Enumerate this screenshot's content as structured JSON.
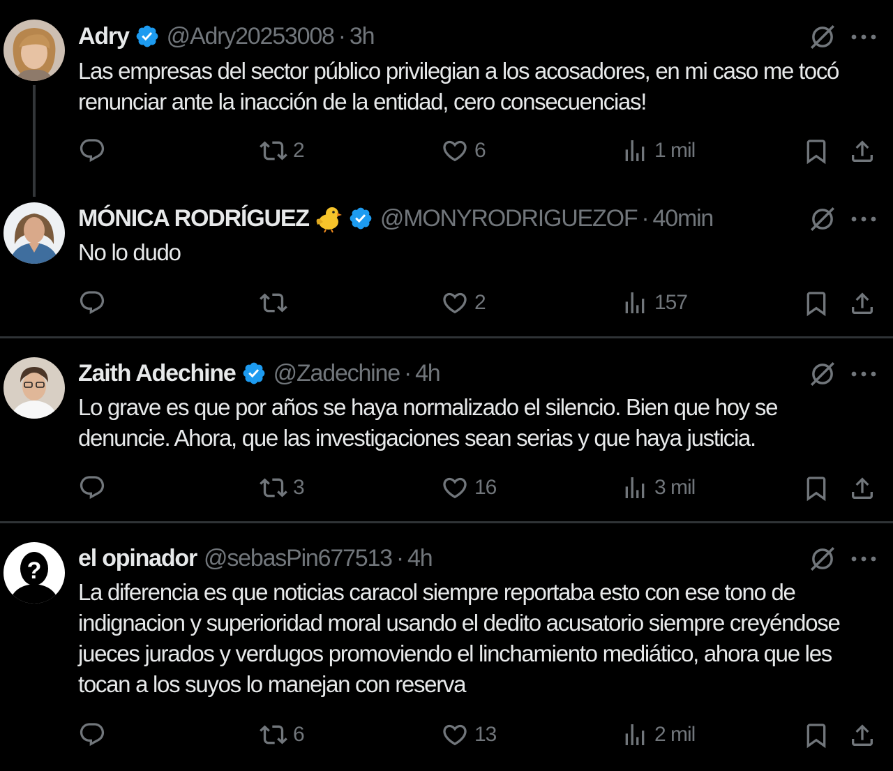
{
  "colors": {
    "background": "#000000",
    "text": "#e7e9ea",
    "muted": "#71767b",
    "verified": "#1d9bf0",
    "divider": "#2f3336"
  },
  "tweets": [
    {
      "name": "Adry",
      "handle": "@Adry20253008",
      "separator": "·",
      "time": "3h",
      "verified": true,
      "text": "Las empresas del sector público privilegian a los acosadores, en mi caso me tocó renunciar ante la inacción de la entidad, cero consecuencias!",
      "replies": "",
      "reposts": "2",
      "likes": "6",
      "views": "1 mil"
    },
    {
      "name": "MÓNICA RODRÍGUEZ",
      "handle": "@MONYRODRIGUEZOF",
      "separator": "·",
      "time": "40min",
      "verified": true,
      "emoji": "chick-emoji-icon",
      "text": "No lo dudo",
      "replies": "",
      "reposts": "",
      "likes": "2",
      "views": "157"
    },
    {
      "name": "Zaith Adechine",
      "handle": "@Zadechine",
      "separator": "·",
      "time": "4h",
      "verified": true,
      "text": "Lo grave es que por años se haya normalizado el silencio. Bien que hoy se denuncie. Ahora, que las investigaciones sean serias y que haya justicia.",
      "replies": "",
      "reposts": "3",
      "likes": "16",
      "views": "3 mil"
    },
    {
      "name": "el opinador",
      "handle": "@sebasPin677513",
      "separator": "·",
      "time": "4h",
      "verified": false,
      "text": "La diferencia es que noticias caracol siempre reportaba esto con ese tono de indignacion y superioridad moral usando el dedito acusatorio siempre creyéndose jueces jurados y verdugos promoviendo el linchamiento mediático, ahora que les tocan a los suyos lo manejan con reserva",
      "replies": "",
      "reposts": "6",
      "likes": "13",
      "views": "2 mil"
    }
  ]
}
